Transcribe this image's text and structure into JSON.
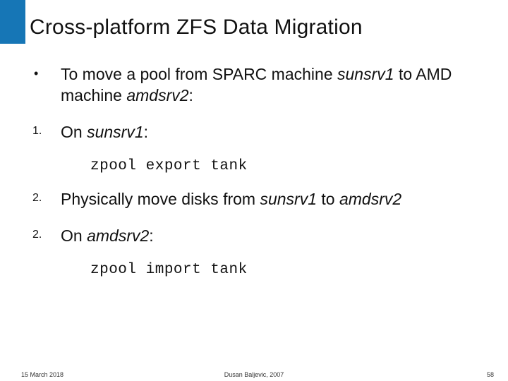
{
  "title": "Cross-platform ZFS Data Migration",
  "intro": {
    "bullet": "•",
    "pre": "To move a pool from SPARC machine ",
    "h1": "sunsrv1",
    "mid": " to AMD machine ",
    "h2": "amdsrv2",
    "post": ":"
  },
  "step1": {
    "num": "1.",
    "pre": "On ",
    "host": "sunsrv1",
    "post": ":",
    "code": "zpool export tank"
  },
  "step2": {
    "num": "2.",
    "pre": "Physically move disks from ",
    "h1": "sunsrv1",
    "mid": " to ",
    "h2": "amdsrv2"
  },
  "step3": {
    "num": "2.",
    "pre": "On ",
    "host": "amdsrv2",
    "post": ":",
    "code": "zpool import tank"
  },
  "footer": {
    "date": "15 March 2018",
    "author": "Dusan Baljevic, 2007",
    "page": "58"
  }
}
